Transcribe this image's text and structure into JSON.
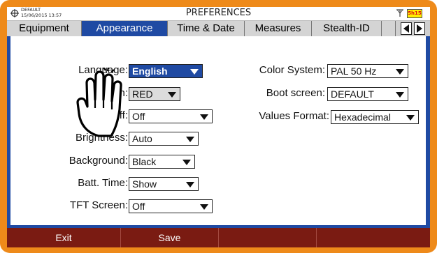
{
  "status": {
    "profile": "DEFAULT",
    "datetime": "15/06/2015 13:57",
    "title": "PREFERENCES",
    "battery": "5h15"
  },
  "tabs": [
    {
      "label": "Equipment"
    },
    {
      "label": "Appearance"
    },
    {
      "label": "Time & Date"
    },
    {
      "label": "Measures"
    },
    {
      "label": "Stealth-ID"
    }
  ],
  "left": {
    "language": {
      "label": "Language:",
      "value": "English"
    },
    "skin": {
      "label": "Skin:",
      "value": "RED"
    },
    "power_off": {
      "label": "Power Off:",
      "value": "Off"
    },
    "brightness": {
      "label": "Brightness:",
      "value": "Auto"
    },
    "background": {
      "label": "Background:",
      "value": "Black"
    },
    "batt_time": {
      "label": "Batt. Time:",
      "value": "Show"
    },
    "tft_screen": {
      "label": "TFT Screen:",
      "value": "Off"
    }
  },
  "right": {
    "color_system": {
      "label": "Color System:",
      "value": "PAL 50 Hz"
    },
    "boot_screen": {
      "label": "Boot screen:",
      "value": "DEFAULT"
    },
    "values_format": {
      "label": "Values Format:",
      "value": "Hexadecimal"
    }
  },
  "footer": {
    "exit": "Exit",
    "save": "Save"
  },
  "icons": {
    "status_left": "satellite-icon",
    "antenna": "antenna-icon",
    "tab_prev": "triangle-left-icon",
    "tab_next": "triangle-right-icon",
    "hand": "pointing-hand-icon"
  },
  "colors": {
    "frame": "#ee8a1a",
    "accent": "#1f4aa3",
    "footer": "#7a1b12"
  }
}
